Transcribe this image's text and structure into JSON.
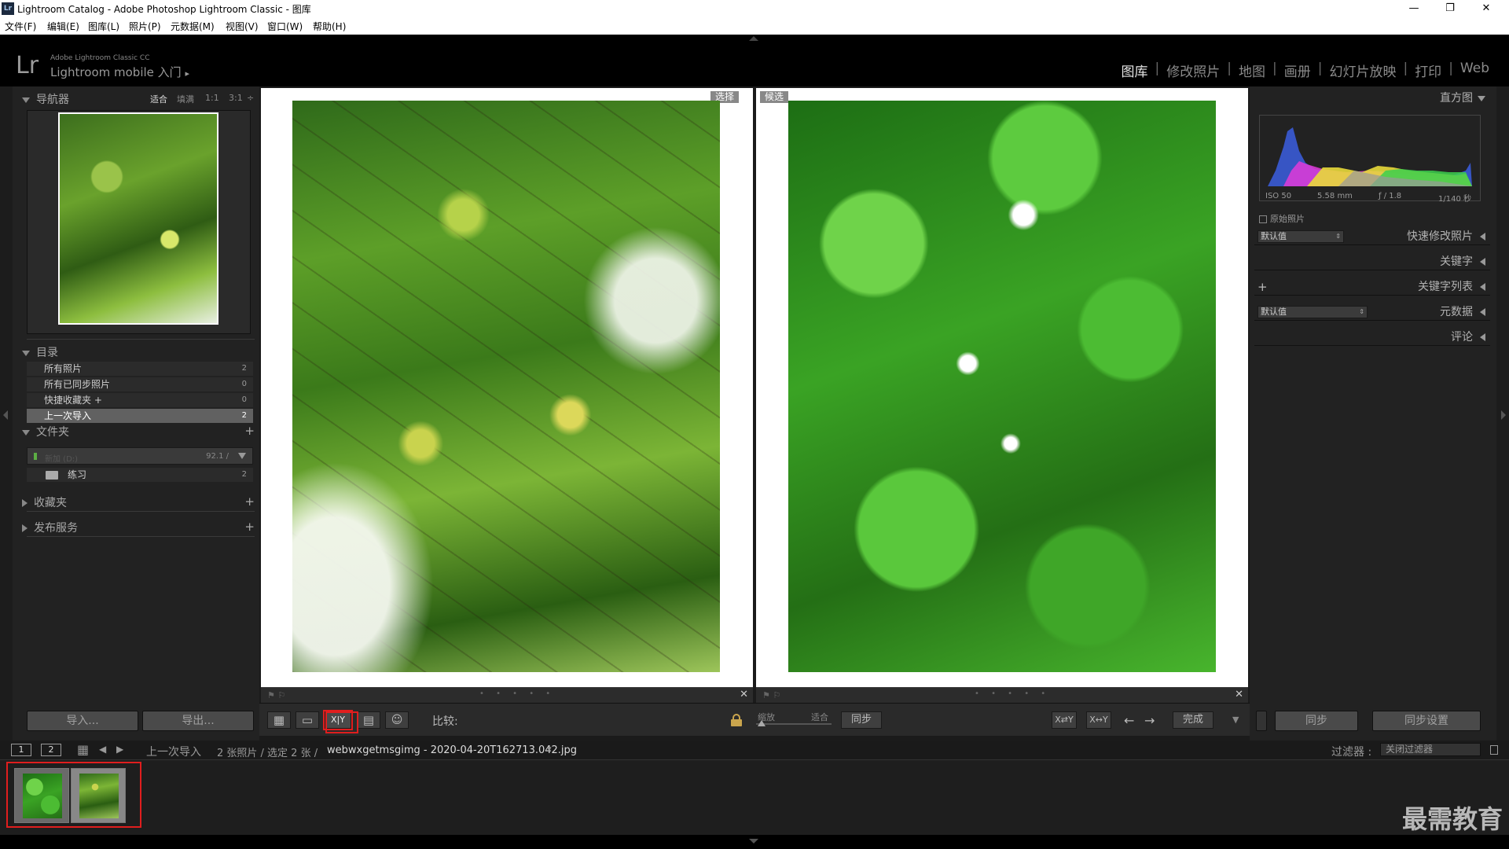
{
  "window": {
    "title": "Lightroom Catalog - Adobe Photoshop Lightroom Classic - 图库",
    "app_badge": "Lr",
    "controls": [
      "—",
      "❐",
      "✕"
    ]
  },
  "menu": [
    "文件(F)",
    "编辑(E)",
    "图库(L)",
    "照片(P)",
    "元数据(M)",
    "视图(V)",
    "窗口(W)",
    "帮助(H)"
  ],
  "identity": {
    "logo": "Lr",
    "product": "Adobe Lightroom Classic CC",
    "mobile": "Lightroom mobile 入门",
    "mobile_arrow": "▸"
  },
  "modules": [
    "图库",
    "修改照片",
    "地图",
    "画册",
    "幻灯片放映",
    "打印",
    "Web"
  ],
  "module_separator": "|",
  "active_module": "图库",
  "left_panel": {
    "navigator": {
      "title": "导航器",
      "zoom": [
        "适合",
        "填满",
        "1:1",
        "3:1",
        "÷"
      ]
    },
    "catalog": {
      "title": "目录",
      "items": [
        {
          "label": "所有照片",
          "count": "2"
        },
        {
          "label": "所有已同步照片",
          "count": "0"
        },
        {
          "label": "快捷收藏夹 +",
          "count": "0"
        },
        {
          "label": "上一次导入",
          "count": "2"
        }
      ]
    },
    "folders": {
      "title": "文件夹",
      "plus": "+",
      "volume_name": "新加 (D:)",
      "volume_size": "92.1 /",
      "folder": {
        "label": "练习",
        "count": "2"
      }
    },
    "collections": {
      "title": "收藏夹",
      "plus": "+"
    },
    "publish": {
      "title": "发布服务",
      "plus": "+"
    },
    "import_btn": "导入...",
    "export_btn": "导出..."
  },
  "compare": {
    "select_tag": "选择",
    "candidate_tag": "候选",
    "left_flag": "⚑ ⚐",
    "right_flag": "⚑ ⚐",
    "dots": "• • • • •",
    "close": "✕"
  },
  "toolbar": {
    "grid_icon": "▦",
    "loupe_icon": "▭",
    "compare_icon": "X|Y",
    "survey_icon": "▤",
    "people_icon": "☺",
    "compare_label": "比较:",
    "zoom_label": "缩放",
    "fit_label": "适合",
    "sync_label": "同步",
    "swap_icon": "X⇄Y",
    "make_select_icon": "X↔Y",
    "prev": "←",
    "next": "→",
    "done": "完成",
    "dropdown": "▼"
  },
  "right_panel": {
    "histogram_title": "直方图",
    "iso": "ISO 50",
    "focal": "5.58 mm",
    "aperture": "ƒ / 1.8",
    "shutter": "1/140 秒",
    "original_photo": "原始照片",
    "quick_develop_preset": "默认值",
    "quick_develop": "快速修改照片",
    "keywording": "关键字",
    "keyword_list_plus": "+",
    "keyword_list": "关键字列表",
    "metadata_preset": "默认值",
    "metadata": "元数据",
    "comments": "评论",
    "sync_btn": "同步",
    "sync_settings_btn": "同步设置"
  },
  "filmstrip_bar": {
    "screen1": "1",
    "screen2": "2",
    "grid": "▦",
    "back": "◀",
    "forward": "▶",
    "source": "上一次导入",
    "info": "2 张照片 / 选定 2 张 /",
    "filename": "webwxgetmsgimg - 2020-04-20T162713.042.jpg",
    "filename_arrow": "▾",
    "filter_label": "过滤器 :",
    "filter_value": "关闭过滤器"
  },
  "watermark": "最需教育",
  "colors": {
    "highlight": "#e01e1e",
    "active_module": "#e6e6e6",
    "panel_bg": "#222222"
  }
}
